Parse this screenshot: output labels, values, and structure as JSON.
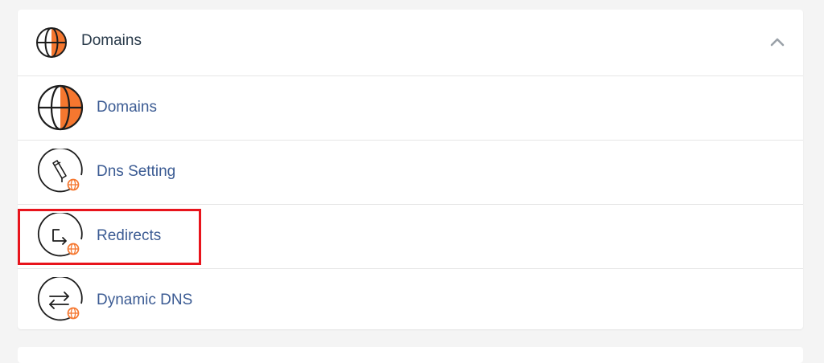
{
  "section": {
    "title": "Domains",
    "header_icon": "globe-icon",
    "toggle_icon": "chevron-up-icon"
  },
  "items": [
    {
      "label": "Domains",
      "icon": "globe-icon"
    },
    {
      "label": "Dns Setting",
      "icon": "dns-setting-icon"
    },
    {
      "label": "Redirects",
      "icon": "redirect-icon"
    },
    {
      "label": "Dynamic DNS",
      "icon": "dynamic-dns-icon"
    }
  ],
  "colors": {
    "accent": "#f5772f",
    "link": "#3b5b93",
    "title": "#293a4a",
    "highlight": "#e8141c"
  }
}
